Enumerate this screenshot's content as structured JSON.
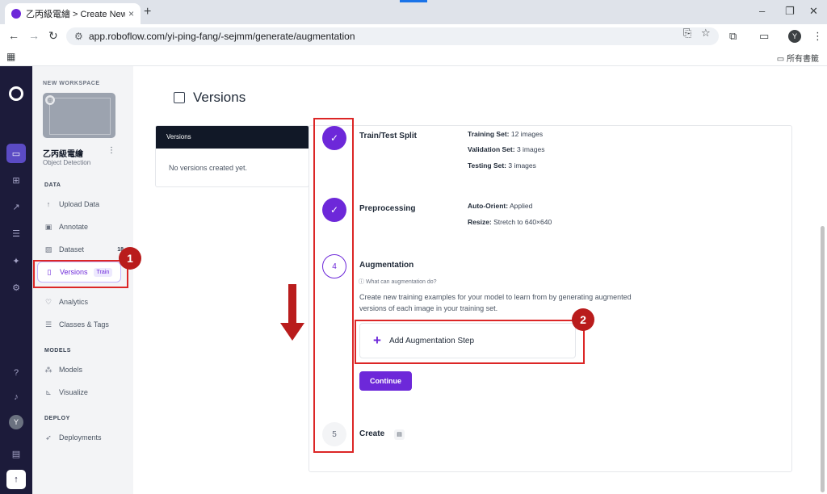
{
  "browser": {
    "tab_title": "乙丙級電繪 > Create New Vers",
    "tab_close": "×",
    "new_tab": "+",
    "url": "app.roboflow.com/yi-ping-fang/-sejmm/generate/augmentation",
    "bookmarks_all": "所有書籤",
    "profile": "Y",
    "window_minimize": "–",
    "window_restore": "❐",
    "window_close": "✕"
  },
  "rail": {
    "avatar": "Y"
  },
  "sidebar": {
    "workspace_label": "NEW WORKSPACE",
    "project_name": "乙丙級電繪",
    "project_type": "Object Detection",
    "section_data": "DATA",
    "section_models": "MODELS",
    "section_deploy": "DEPLOY",
    "items": {
      "upload": "Upload Data",
      "annotate": "Annotate",
      "dataset": "Dataset",
      "dataset_count": "18",
      "versions": "Versions",
      "versions_badge": "Train",
      "analytics": "Analytics",
      "classes": "Classes & Tags",
      "models": "Models",
      "visualize": "Visualize",
      "deployments": "Deployments"
    }
  },
  "main": {
    "title": "Versions",
    "versions_panel": {
      "header": "Versions",
      "empty": "No versions created yet."
    },
    "steps": {
      "split": {
        "title": "Train/Test Split",
        "training_label": "Training Set:",
        "training_value": "12 images",
        "validation_label": "Validation Set:",
        "validation_value": "3 images",
        "testing_label": "Testing Set:",
        "testing_value": "3 images"
      },
      "preprocessing": {
        "title": "Preprocessing",
        "orient_label": "Auto-Orient:",
        "orient_value": "Applied",
        "resize_label": "Resize:",
        "resize_value": "Stretch to 640×640"
      },
      "augmentation": {
        "number": "4",
        "title": "Augmentation",
        "help": "What can augmentation do?",
        "description": "Create new training examples for your model to learn from by generating augmented versions of each image in your training set.",
        "add_step": "Add Augmentation Step",
        "continue": "Continue"
      },
      "create": {
        "number": "5",
        "title": "Create"
      }
    }
  },
  "annotations": {
    "badge1": "1",
    "badge2": "2"
  }
}
